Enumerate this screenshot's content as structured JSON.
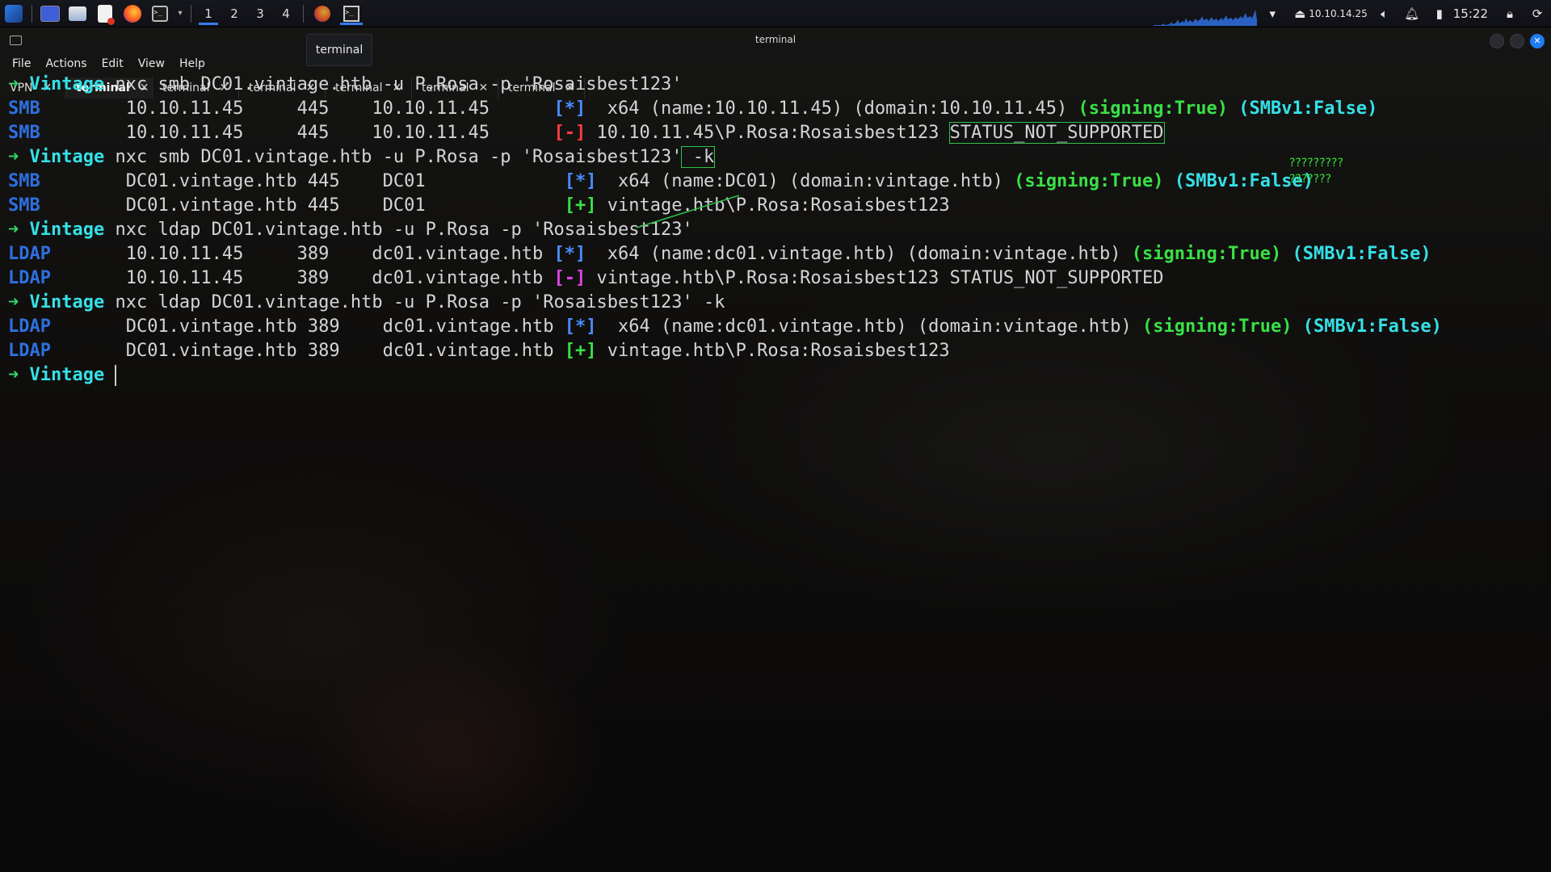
{
  "taskbar": {
    "workspaces": [
      "1",
      "2",
      "3",
      "4"
    ],
    "active_workspace": 0,
    "ip": "10.10.14.25",
    "clock": "15:22",
    "accent": "#367bf0"
  },
  "window": {
    "title": "terminal",
    "tooltip": "terminal"
  },
  "menu": [
    "File",
    "Actions",
    "Edit",
    "View",
    "Help"
  ],
  "tabs": [
    {
      "label": "VPN",
      "active": false
    },
    {
      "label": "terminal",
      "active": true
    },
    {
      "label": "terminal",
      "active": false
    },
    {
      "label": "terminal",
      "active": false
    },
    {
      "label": "terminal",
      "active": false
    },
    {
      "label": "terminal",
      "active": false
    },
    {
      "label": "terminal",
      "active": false
    }
  ],
  "terminal": {
    "prompt_arrow": "➜",
    "prompt_name": "Vintage",
    "lines": [
      {
        "type": "cmd",
        "text": " nxc smb DC01.vintage.htb -u P.Rosa -p 'Rosaisbest123'"
      },
      {
        "type": "out",
        "proto": "SMB",
        "mid": "        10.10.11.45     445    10.10.11.45      ",
        "badge": "[*]",
        "badge_class": "b-info",
        "rest": "  x64 (name:10.10.11.45) (domain:10.10.11.45) ",
        "sign": "(signing:True)",
        "smb": "(SMBv1:False)"
      },
      {
        "type": "out",
        "proto": "SMB",
        "mid": "        10.10.11.45     445    10.10.11.45      ",
        "badge": "[-]",
        "badge_class": "b-err",
        "rest": " 10.10.11.45\\P.Rosa:Rosaisbest123 ",
        "boxed": "STATUS_NOT_SUPPORTED"
      },
      {
        "type": "cmd",
        "text": " nxc smb DC01.vintage.htb -u P.Rosa -p 'Rosaisbest123'",
        "boxed_suffix": " -k"
      },
      {
        "type": "out",
        "proto": "SMB",
        "mid": "        DC01.vintage.htb 445    DC01             ",
        "badge": "[*]",
        "badge_class": "b-info",
        "rest": "  x64 (name:DC01) (domain:vintage.htb) ",
        "sign": "(signing:True)",
        "smb": "(SMBv1:False)"
      },
      {
        "type": "out",
        "proto": "SMB",
        "mid": "        DC01.vintage.htb 445    DC01             ",
        "badge": "[+]",
        "badge_class": "b-ok",
        "rest": " vintage.htb\\P.Rosa:Rosaisbest123"
      },
      {
        "type": "cmd",
        "text": " nxc ldap DC01.vintage.htb -u P.Rosa -p 'Rosaisbest123'"
      },
      {
        "type": "out",
        "proto": "LDAP",
        "mid": "       10.10.11.45     389    dc01.vintage.htb ",
        "badge": "[*]",
        "badge_class": "b-info",
        "rest": "  x64 (name:dc01.vintage.htb) (domain:vintage.htb) ",
        "sign": "(signing:True)",
        "smb": "(SMBv1:False)"
      },
      {
        "type": "out",
        "proto": "LDAP",
        "mid": "       10.10.11.45     389    dc01.vintage.htb ",
        "badge": "[-]",
        "badge_class": "b-errm",
        "rest": " vintage.htb\\P.Rosa:Rosaisbest123 STATUS_NOT_SUPPORTED"
      },
      {
        "type": "cmd",
        "text": " nxc ldap DC01.vintage.htb -u P.Rosa -p 'Rosaisbest123' -k"
      },
      {
        "type": "out",
        "proto": "LDAP",
        "mid": "       DC01.vintage.htb 389    dc01.vintage.htb ",
        "badge": "[*]",
        "badge_class": "b-info",
        "rest": "  x64 (name:dc01.vintage.htb) (domain:vintage.htb) ",
        "sign": "(signing:True)",
        "smb": "(SMBv1:False)"
      },
      {
        "type": "out",
        "proto": "LDAP",
        "mid": "       DC01.vintage.htb 389    dc01.vintage.htb ",
        "badge": "[+]",
        "badge_class": "b-ok",
        "rest": " vintage.htb\\P.Rosa:Rosaisbest123"
      },
      {
        "type": "prompt"
      }
    ]
  },
  "annotation": {
    "line1": "?????????",
    "line2": "???????",
    "color": "#33e033"
  },
  "icons": [
    "kali-menu-icon",
    "desktop-icon",
    "file-manager-icon",
    "text-editor-icon",
    "firefox-icon",
    "terminal-icon",
    "wifi-icon",
    "vpn-user-icon",
    "volume-icon",
    "bell-icon",
    "battery-icon",
    "lock-icon",
    "power-icon"
  ]
}
